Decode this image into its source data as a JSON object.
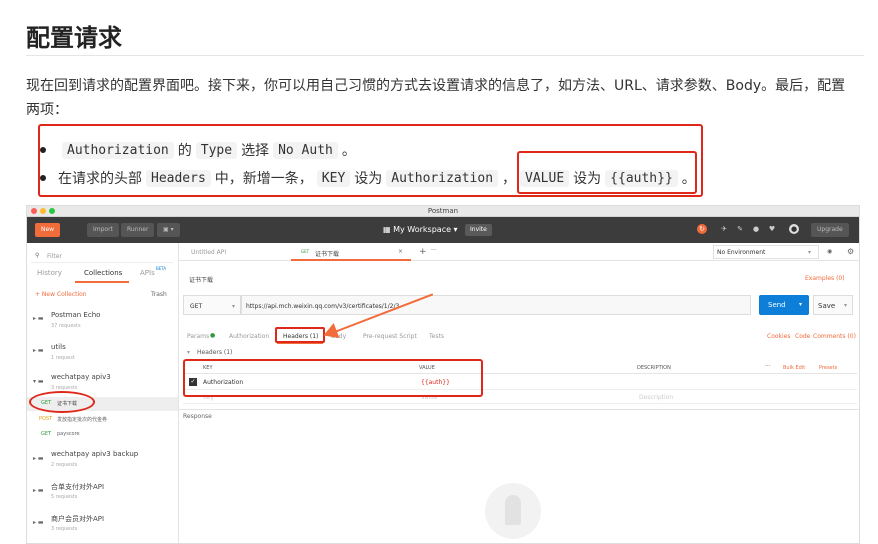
{
  "article": {
    "heading": "配置请求",
    "intro": "现在回到请求的配置界面吧。接下来，你可以用自己习惯的方式去设置请求的信息了，如方法、URL、请求参数、Body。最后，配置两项：",
    "bullet1": {
      "code1": "Authorization",
      "t1": "的",
      "code2": "Type",
      "t2": "选择",
      "code3": "No Auth",
      "t3": "。"
    },
    "bullet2": {
      "t1": "在请求的头部",
      "code1": "Headers",
      "t2": "中，新增一条，",
      "code2": "KEY",
      "t3": "设为",
      "code3": "Authorization",
      "t4": "，",
      "code4": "VALUE",
      "t5": "设为",
      "code5": "{{auth}}",
      "t6": "。"
    }
  },
  "postman": {
    "window_title": "Postman",
    "toolbar": {
      "new": "New",
      "import": "Import",
      "runner": "Runner",
      "workspace": "My Workspace",
      "invite": "Invite",
      "upgrade": "Upgrade"
    },
    "sidebar": {
      "filter_placeholder": "Filter",
      "tabs": [
        "History",
        "Collections",
        "APIs"
      ],
      "beta": "BETA",
      "new_collection": "+ New Collection",
      "trash": "Trash",
      "collections": [
        {
          "name": "Postman Echo",
          "count": "37 requests"
        },
        {
          "name": "utils",
          "count": "1 request"
        },
        {
          "name": "wechatpay apiv3",
          "count": "3 requests"
        },
        {
          "name": "wechatpay apiv3 backup",
          "count": "2 requests"
        },
        {
          "name": "合单支付对外API",
          "count": "5 requests"
        },
        {
          "name": "商户会员对外API",
          "count": "3 requests"
        }
      ],
      "requests": [
        {
          "method": "GET",
          "name": "证书下载"
        },
        {
          "method": "POST",
          "name": "发放指定批次的代金券"
        },
        {
          "method": "GET",
          "name": "payscore"
        }
      ]
    },
    "tabs": {
      "untitled": "Untitled API",
      "active_method": "GET",
      "active": "证书下载",
      "env": "No Environment"
    },
    "request": {
      "breadcrumb": "证书下载",
      "examples": "Examples (0)",
      "method": "GET",
      "url": "https://api.mch.weixin.qq.com/v3/certificates/1/2/3",
      "send": "Send",
      "save": "Save",
      "subtabs": [
        "Params",
        "Authorization",
        "Headers (1)",
        "Body",
        "Pre-request Script",
        "Tests"
      ],
      "right_links": [
        "Cookies",
        "Code",
        "Comments (0)"
      ],
      "headers_title": "Headers (1)",
      "cols": [
        "KEY",
        "VALUE",
        "DESCRIPTION"
      ],
      "bulk_edit": "Bulk Edit",
      "presets": "Presets",
      "row_key": "Authorization",
      "row_value": "{{auth}}",
      "ph_key": "Key",
      "ph_value": "Value",
      "ph_desc": "Description",
      "response": "Response"
    }
  }
}
